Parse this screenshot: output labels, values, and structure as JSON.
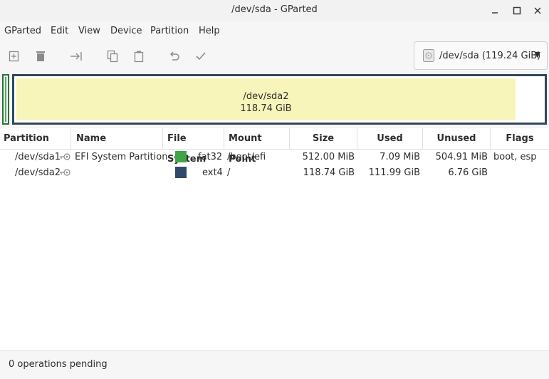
{
  "window": {
    "title": "/dev/sda - GParted"
  },
  "menu": [
    "GParted",
    "Edit",
    "View",
    "Device",
    "Partition",
    "Help"
  ],
  "toolbar": {
    "icons": [
      "new-partition-icon",
      "delete-icon",
      "resize-move-icon",
      "copy-icon",
      "paste-icon",
      "undo-icon",
      "apply-icon"
    ]
  },
  "device": {
    "label": "/dev/sda (119.24 GiB)"
  },
  "diskmap": {
    "partition2": {
      "name": "/dev/sda2",
      "size": "118.74 GiB",
      "used_color": "#f7f5b9",
      "border_color": "#32465e"
    },
    "partition1": {
      "border_color": "#2e6f40",
      "fill_color": "#4bb14b"
    }
  },
  "table": {
    "headers": [
      "Partition",
      "Name",
      "File System",
      "Mount Point",
      "Size",
      "Used",
      "Unused",
      "Flags"
    ],
    "rows": [
      {
        "partition": "/dev/sda1",
        "name": "EFI System Partition",
        "fs_color": "#3fa546",
        "filesystem": "fat32",
        "mount": "/boot/efi",
        "size": "512.00 MiB",
        "used": "7.09 MiB",
        "unused": "504.91 MiB",
        "flags": "boot, esp"
      },
      {
        "partition": "/dev/sda2",
        "name": "",
        "fs_color": "#2f4a6a",
        "filesystem": "ext4",
        "mount": "/",
        "size": "118.74 GiB",
        "used": "111.99 GiB",
        "unused": "6.76 GiB",
        "flags": ""
      }
    ]
  },
  "status": {
    "text": "0 operations pending"
  }
}
